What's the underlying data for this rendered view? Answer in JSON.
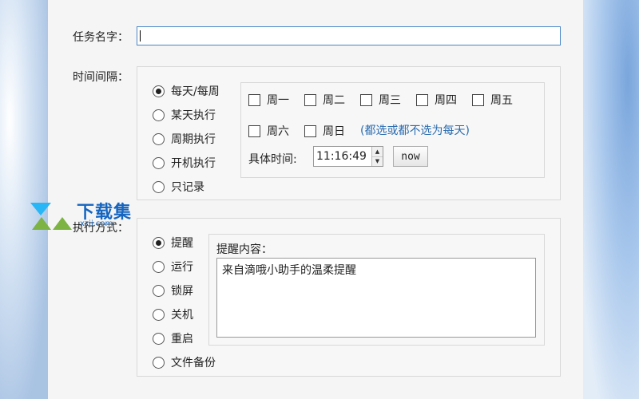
{
  "task_name": {
    "label": "任务名字：",
    "value": ""
  },
  "interval": {
    "label": "时间间隔：",
    "options": [
      {
        "label": "每天/每周",
        "selected": true
      },
      {
        "label": "某天执行",
        "selected": false
      },
      {
        "label": "周期执行",
        "selected": false
      },
      {
        "label": "开机执行",
        "selected": false
      },
      {
        "label": "只记录",
        "selected": false
      }
    ],
    "weekdays": [
      "周一",
      "周二",
      "周三",
      "周四",
      "周五",
      "周六",
      "周日"
    ],
    "weekday_hint": "(都选或都不选为每天)",
    "time_label": "具体时间:",
    "time_value": "11:16:49",
    "now_label": "now"
  },
  "action": {
    "label": "执行方式：",
    "options": [
      {
        "label": "提醒",
        "selected": true
      },
      {
        "label": "运行",
        "selected": false
      },
      {
        "label": "锁屏",
        "selected": false
      },
      {
        "label": "关机",
        "selected": false
      },
      {
        "label": "重启",
        "selected": false
      },
      {
        "label": "文件备份",
        "selected": false
      }
    ],
    "reminder_label": "提醒内容：",
    "reminder_text": "来自滴哦小助手的温柔提醒"
  },
  "watermark": {
    "text": "下载集",
    "sub": "xzji.com"
  },
  "colors": {
    "accent": "#4a86c8",
    "hint": "#2b6cb0",
    "logo": "#1565c0"
  }
}
